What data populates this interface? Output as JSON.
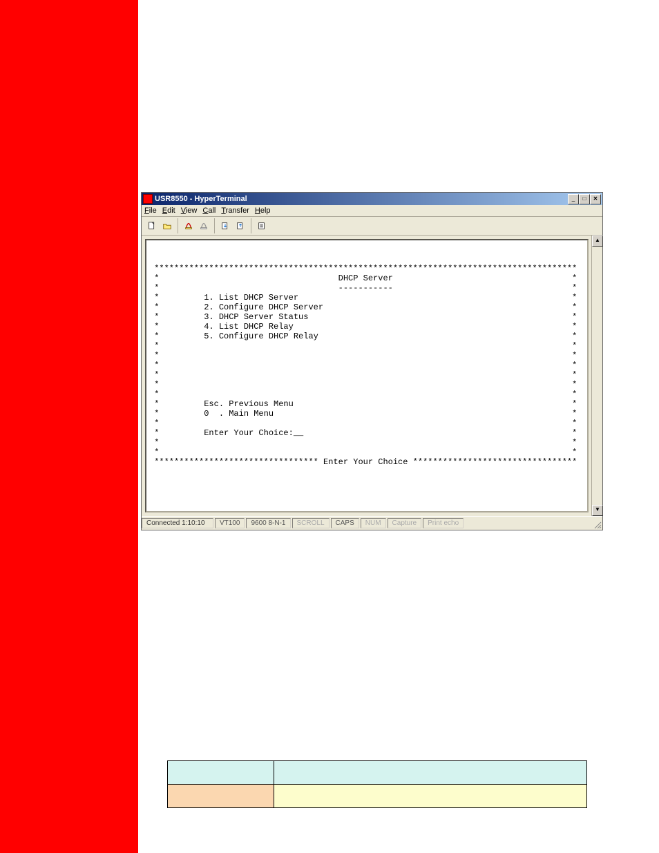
{
  "window": {
    "title": "USR8550 - HyperTerminal",
    "min_label": "_",
    "max_label": "□",
    "close_label": "✕"
  },
  "menu": {
    "file": "File",
    "edit": "Edit",
    "view": "View",
    "call": "Call",
    "transfer": "Transfer",
    "help": "Help"
  },
  "terminal": {
    "header_rule": "***********************************************************************************",
    "title": "DHCP Server",
    "title_underline": "-----------",
    "items": [
      "1. List DHCP Server",
      "2. Configure DHCP Server",
      "3. DHCP Server Status",
      "4. List DHCP Relay",
      "5. Configure DHCP Relay"
    ],
    "nav1": "Esc. Previous Menu",
    "nav2": "0  . Main Menu",
    "prompt": "Enter Your Choice:__",
    "footer_rule_left": "*****************************",
    "footer_text": " Enter Your Choice ",
    "footer_rule_right": "****************************"
  },
  "status": {
    "connected": "Connected 1:10:10",
    "emu": "VT100",
    "settings": "9600 8-N-1",
    "scroll": "SCROLL",
    "caps": "CAPS",
    "num": "NUM",
    "capture": "Capture",
    "printecho": "Print echo"
  },
  "scroll": {
    "up": "▲",
    "down": "▼"
  }
}
